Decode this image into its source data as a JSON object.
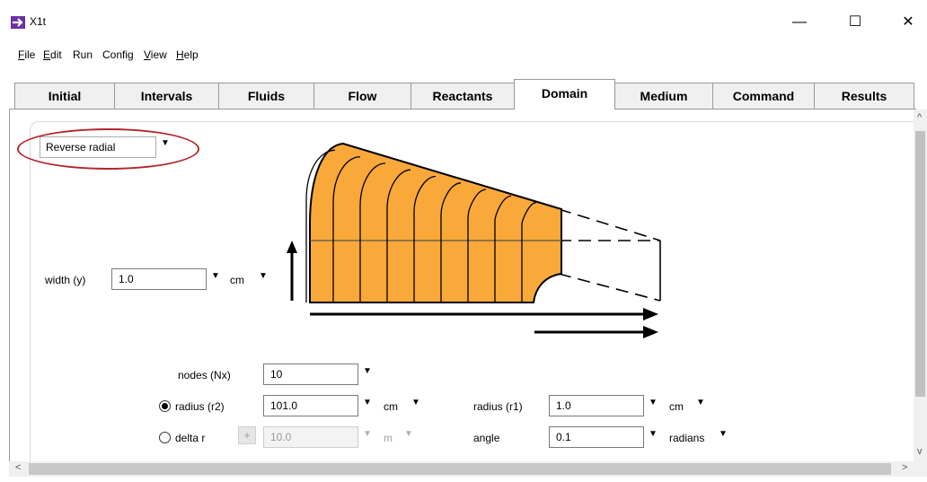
{
  "window": {
    "title": "X1t",
    "minimize_glyph": "—",
    "maximize_glyph": "☐",
    "close_glyph": "✕"
  },
  "menu": [
    {
      "label": "File",
      "mnemonic": "F",
      "rest": "ile"
    },
    {
      "label": "Edit",
      "mnemonic": "E",
      "rest": "dit"
    },
    {
      "label": "Run",
      "mnemonic": "",
      "rest": "Run"
    },
    {
      "label": "Config",
      "mnemonic": "",
      "rest": "Config"
    },
    {
      "label": "View",
      "mnemonic": "V",
      "rest": "iew"
    },
    {
      "label": "Help",
      "mnemonic": "H",
      "rest": "elp"
    }
  ],
  "tabs": [
    "Initial",
    "Intervals",
    "Fluids",
    "Flow",
    "Reactants",
    "Domain",
    "Medium",
    "Command",
    "Results"
  ],
  "active_tab": "Domain",
  "domain": {
    "geometry_select": "Reverse radial",
    "width_label": "width (y)",
    "width_value": "1.0",
    "width_unit": "cm",
    "nodes_label": "nodes (Nx)",
    "nodes_value": "10",
    "radius_r2_label": "radius (r2)",
    "radius_r2_value": "101.0",
    "radius_r2_unit": "cm",
    "delta_r_label": "delta r",
    "delta_r_value": "10.0",
    "delta_r_unit": "m",
    "delta_plus": "+",
    "radius_r1_label": "radius (r1)",
    "radius_r1_value": "1.0",
    "radius_r1_unit": "cm",
    "angle_label": "angle",
    "angle_value": "0.1",
    "angle_unit": "radians"
  },
  "diagram": {
    "fill_color": "#f9a83a",
    "outline_color": "#000000",
    "grid_columns": 10
  },
  "dropdown_glyph": "▼",
  "scroll": {
    "up": "^",
    "down": "v",
    "left": "<",
    "right": ">"
  }
}
